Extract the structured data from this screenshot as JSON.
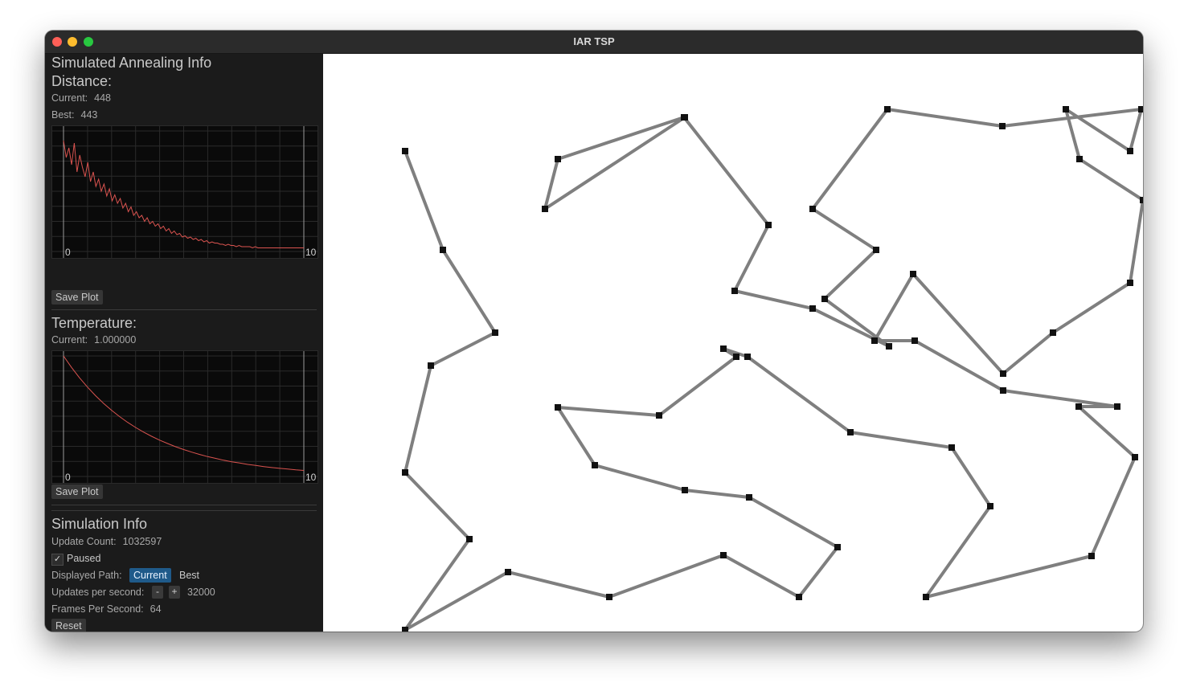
{
  "window": {
    "title": "IAR TSP"
  },
  "sidebar": {
    "section_title": "Simulated Annealing Info",
    "distance": {
      "heading": "Distance:",
      "current_label": "Current:",
      "current_value": "448",
      "best_label": "Best:",
      "best_value": "443",
      "save_label": "Save Plot"
    },
    "temperature": {
      "heading": "Temperature:",
      "current_label": "Current:",
      "current_value": "1.000000",
      "save_label": "Save Plot"
    },
    "sim": {
      "heading": "Simulation Info",
      "update_count_label": "Update Count:",
      "update_count_value": "1032597",
      "paused_label": "Paused",
      "paused_checked": true,
      "check_mark": "✓",
      "displayed_path_label": "Displayed Path:",
      "path_options": [
        "Current",
        "Best"
      ],
      "path_selected": "Current",
      "ups_label": "Updates per second:",
      "ups_minus": "-",
      "ups_plus": "+",
      "ups_value": "32000",
      "fps_label": "Frames Per Second:",
      "fps_value": "64",
      "reset_label": "Reset"
    }
  },
  "chart_data": [
    {
      "type": "line",
      "title": "",
      "x_tick_labels": [
        "0",
        "10"
      ],
      "series_color": "#d9534f",
      "grid": true,
      "note_values": "noisy exponential decay of tour distance",
      "series": [
        {
          "values": [
            0.92,
            0.78,
            0.86,
            0.72,
            0.9,
            0.66,
            0.8,
            0.7,
            0.62,
            0.74,
            0.58,
            0.66,
            0.54,
            0.6,
            0.5,
            0.56,
            0.46,
            0.52,
            0.42,
            0.47,
            0.4,
            0.44,
            0.36,
            0.4,
            0.33,
            0.37,
            0.3,
            0.33,
            0.28,
            0.3,
            0.25,
            0.28,
            0.23,
            0.25,
            0.21,
            0.23,
            0.19,
            0.21,
            0.17,
            0.19,
            0.15,
            0.17,
            0.14,
            0.15,
            0.12,
            0.13,
            0.11,
            0.12,
            0.1,
            0.11,
            0.09,
            0.1,
            0.08,
            0.09,
            0.07,
            0.08,
            0.07,
            0.07,
            0.06,
            0.06,
            0.05,
            0.06,
            0.05,
            0.05,
            0.04,
            0.05,
            0.04,
            0.04,
            0.04,
            0.04,
            0.03,
            0.04,
            0.03,
            0.03,
            0.03,
            0.03,
            0.03,
            0.03,
            0.03,
            0.03,
            0.03,
            0.03,
            0.03,
            0.03,
            0.03,
            0.03,
            0.03,
            0.03,
            0.03,
            0.03
          ]
        }
      ]
    },
    {
      "type": "line",
      "title": "",
      "x_tick_labels": [
        "0",
        "10"
      ],
      "series_color": "#d9534f",
      "grid": true,
      "series": [
        {
          "values": [
            1.0,
            0.905,
            0.819,
            0.741,
            0.67,
            0.607,
            0.549,
            0.497,
            0.449,
            0.407,
            0.368,
            0.333,
            0.301,
            0.273,
            0.247,
            0.223,
            0.202,
            0.183,
            0.165,
            0.15,
            0.135,
            0.122,
            0.111,
            0.1,
            0.091,
            0.082,
            0.074,
            0.067,
            0.061,
            0.055,
            0.05
          ]
        }
      ]
    },
    {
      "type": "scatter",
      "title": "",
      "point_color": "#111111",
      "path_color": "#7f7f7f",
      "series": [
        {
          "x": [
            50,
            97,
            162,
            82,
            50,
            130,
            50,
            178,
            304,
            446,
            540,
            588,
            478,
            398,
            286,
            240,
            366,
            462,
            446,
            476,
            604,
            730,
            778,
            698,
            904,
            958,
            888,
            936,
            794,
            684,
            634,
            682,
            794,
            856,
            952,
            968,
            889,
            872,
            952,
            966,
            793,
            650,
            557,
            636,
            572,
            652,
            557,
            460,
            502,
            397,
            240,
            224,
            398
          ],
          "y": [
            86,
            209,
            312,
            353,
            486,
            569,
            682,
            610,
            641,
            589,
            641,
            579,
            517,
            508,
            477,
            405,
            415,
            342,
            332,
            342,
            436,
            455,
            528,
            641,
            590,
            467,
            404,
            404,
            384,
            322,
            322,
            239,
            363,
            312,
            250,
            147,
            96,
            34,
            86,
            34,
            55,
            34,
            158,
            209,
            270,
            329,
            282,
            260,
            178,
            44,
            96,
            158,
            44
          ]
        }
      ]
    }
  ]
}
